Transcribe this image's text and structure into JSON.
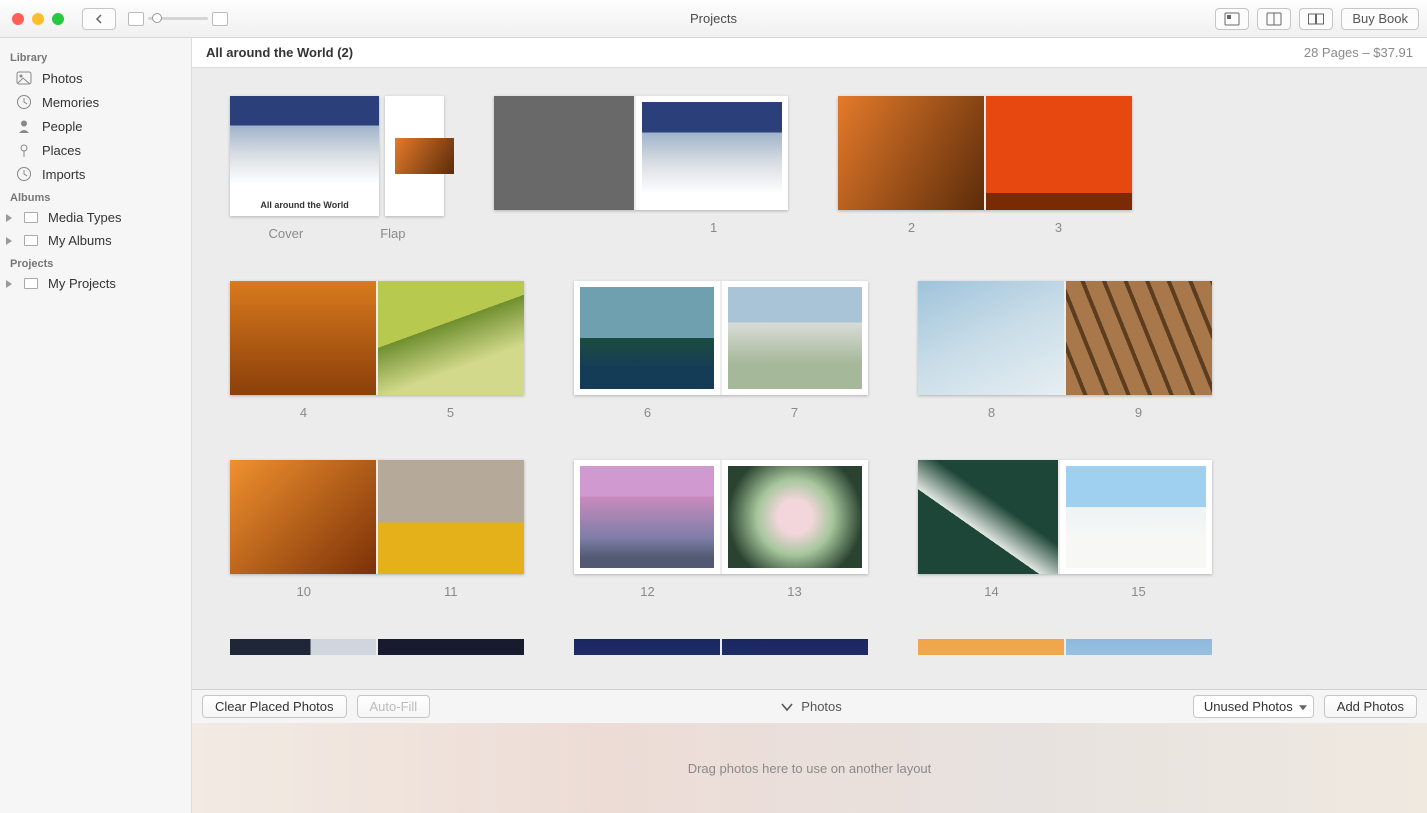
{
  "window": {
    "title": "Projects",
    "buyLabel": "Buy Book"
  },
  "sidebar": {
    "sections": {
      "library": "Library",
      "albums": "Albums",
      "projects": "Projects"
    },
    "items": {
      "photos": "Photos",
      "memories": "Memories",
      "people": "People",
      "places": "Places",
      "imports": "Imports",
      "mediaTypes": "Media Types",
      "myAlbums": "My Albums",
      "myProjects": "My Projects"
    }
  },
  "project": {
    "title": "All around the World (2)",
    "pagesPrice": "28 Pages – $37.91",
    "coverTitle": "All around the World"
  },
  "pages": {
    "coverLabel": "Cover",
    "flapLabel": "Flap",
    "p1": "1",
    "p2": "2",
    "p3": "3",
    "p4": "4",
    "p5": "5",
    "p6": "6",
    "p7": "7",
    "p8": "8",
    "p9": "9",
    "p10": "10",
    "p11": "11",
    "p12": "12",
    "p13": "13",
    "p14": "14",
    "p15": "15"
  },
  "bottom": {
    "clear": "Clear Placed Photos",
    "autoFill": "Auto-Fill",
    "photos": "Photos",
    "unused": "Unused Photos",
    "add": "Add Photos",
    "tray": "Drag photos here to use on another layout"
  }
}
